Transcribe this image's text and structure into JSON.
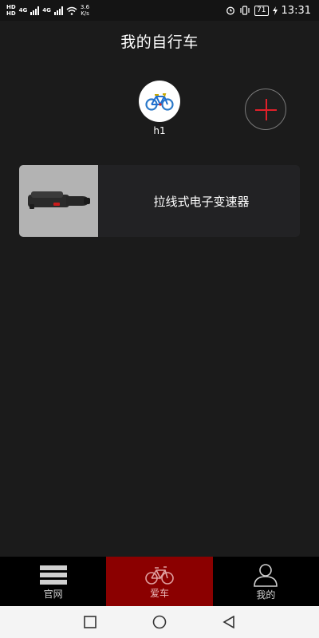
{
  "status_bar": {
    "hd1": "HD",
    "hd2": "HD",
    "net1": "4G",
    "net2": "4G",
    "speed_value": "3.6",
    "speed_unit": "K/s",
    "battery": "71",
    "time": "13:31"
  },
  "header": {
    "title": "我的自行车"
  },
  "bikes": [
    {
      "name": "h1",
      "icon": "bicycle-icon"
    }
  ],
  "add_button": {
    "icon": "plus-icon"
  },
  "devices": [
    {
      "label": "拉线式电子变速器",
      "icon": "derailleur-device-icon"
    }
  ],
  "bottom_nav": {
    "items": [
      {
        "label": "官网",
        "icon": "menu-lines-icon",
        "active": false
      },
      {
        "label": "爱车",
        "icon": "bicycle-icon",
        "active": true
      },
      {
        "label": "我的",
        "icon": "user-icon",
        "active": false
      }
    ]
  },
  "system_nav": {
    "icons": [
      "square-icon",
      "circle-icon",
      "triangle-back-icon"
    ]
  },
  "colors": {
    "background": "#1b1b1b",
    "accent_red": "#e0202a",
    "active_tab": "#8b0000",
    "card": "#222224"
  }
}
